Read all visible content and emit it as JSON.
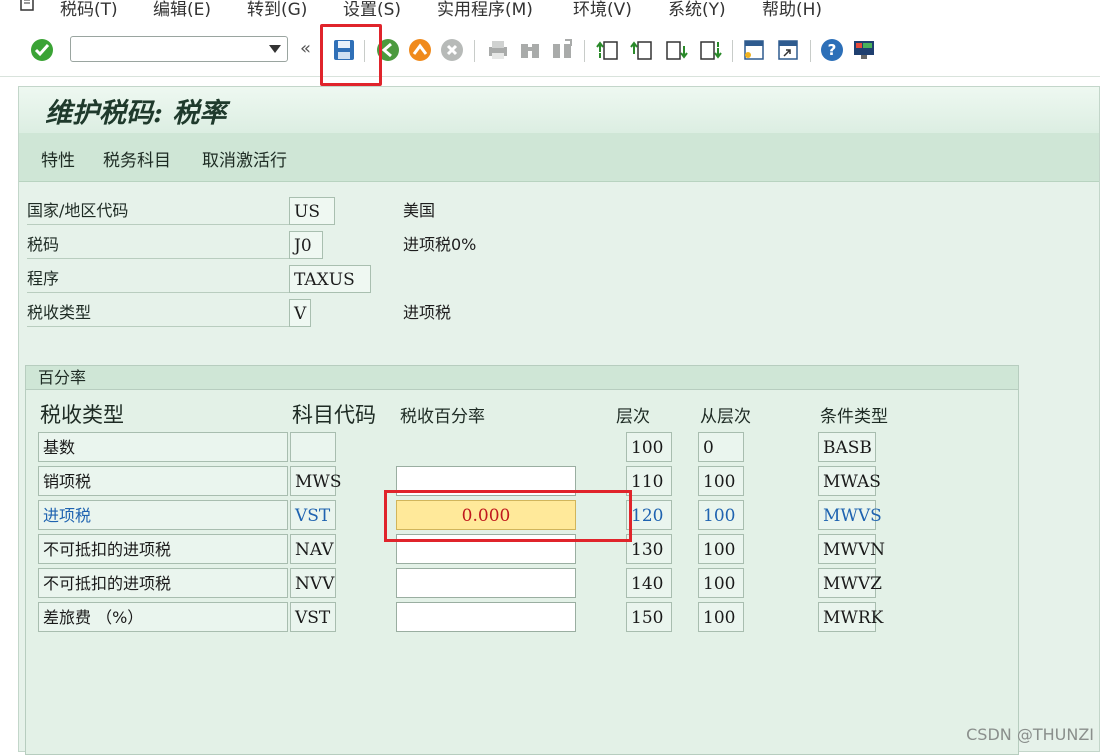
{
  "menu": {
    "items": [
      "税码(T)",
      "编辑(E)",
      "转到(G)",
      "设置(S)",
      "实用程序(M)",
      "环境(V)",
      "系统(Y)",
      "帮助(H)"
    ]
  },
  "toolbar": {
    "command_value": "",
    "double_arrow": "«"
  },
  "page": {
    "title": "维护税码: 税率"
  },
  "app_toolbar": [
    "特性",
    "税务科目",
    "取消激活行"
  ],
  "header_fields": [
    {
      "label": "国家/地区代码",
      "value": "US",
      "desc": "美国"
    },
    {
      "label": "税码",
      "value": "J0",
      "desc": "进项税0%"
    },
    {
      "label": "程序",
      "value": "TAXUS",
      "desc": ""
    },
    {
      "label": "税收类型",
      "value": "V",
      "desc": "进项税"
    }
  ],
  "group": {
    "title": "百分率",
    "columns": {
      "tax_type": "税收类型",
      "account_key": "科目代码",
      "rate": "税收百分率",
      "level": "层次",
      "from_level": "从层次",
      "condition": "条件类型"
    },
    "rows": [
      {
        "name": "基数",
        "key": "",
        "rate": null,
        "level": "100",
        "from": "0",
        "cond": "BASB"
      },
      {
        "name": "销项税",
        "key": "MWS",
        "rate": "",
        "level": "110",
        "from": "100",
        "cond": "MWAS"
      },
      {
        "name": "进项税",
        "key": "VST",
        "rate": "0.000",
        "level": "120",
        "from": "100",
        "cond": "MWVS"
      },
      {
        "name": "不可抵扣的进项税",
        "key": "NAV",
        "rate": "",
        "level": "130",
        "from": "100",
        "cond": "MWVN"
      },
      {
        "name": "不可抵扣的进项税",
        "key": "NVV",
        "rate": "",
        "level": "140",
        "from": "100",
        "cond": "MWVZ"
      },
      {
        "name": "差旅费 （%）",
        "key": "VST",
        "rate": "",
        "level": "150",
        "from": "100",
        "cond": "MWRK"
      }
    ]
  },
  "watermark": "CSDN @THUNZI",
  "colors": {
    "highlight": "#e0242b",
    "focus_bg": "#ffe99a",
    "selected_text": "#1f63b0"
  }
}
